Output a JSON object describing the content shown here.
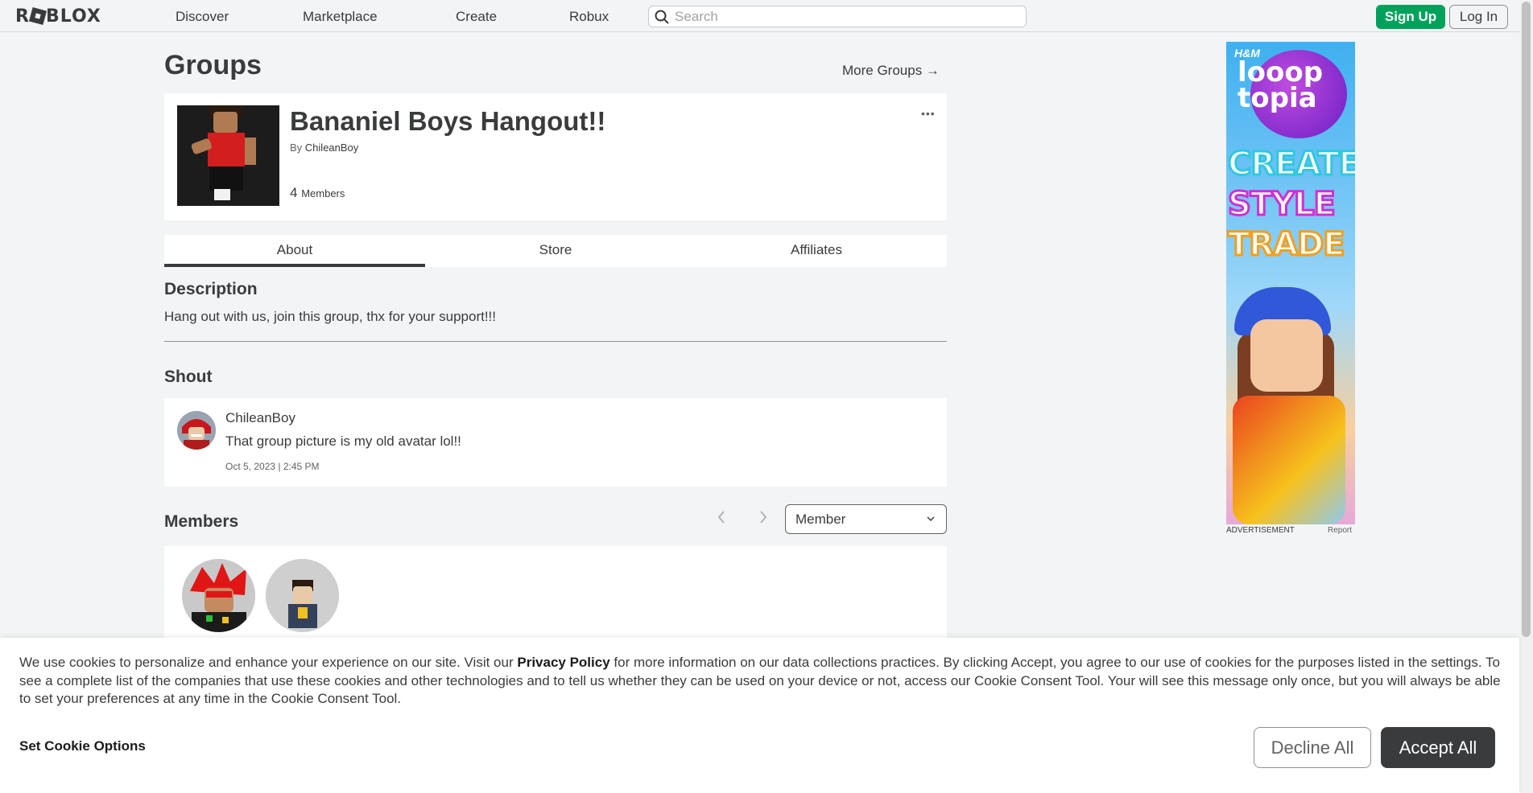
{
  "nav": {
    "logo": "ROBLOX",
    "links": [
      "Discover",
      "Marketplace",
      "Create",
      "Robux"
    ],
    "search_placeholder": "Search",
    "signup_label": "Sign Up",
    "login_label": "Log In"
  },
  "page": {
    "title": "Groups",
    "more_groups": "More Groups →"
  },
  "group": {
    "name": "Bananiel Boys Hangout!!",
    "by_prefix": "By",
    "owner": "ChileanBoy",
    "member_count": "4",
    "members_label": "Members",
    "menu_dots": "•••"
  },
  "tabs": [
    "About",
    "Store",
    "Affiliates"
  ],
  "about": {
    "description_heading": "Description",
    "description": "Hang out with us, join this group, thx for your support!!!",
    "shout_heading": "Shout",
    "shout": {
      "user": "ChileanBoy",
      "text": "That group picture is my old avatar lol!!",
      "time": "Oct 5, 2023 | 2:45 PM"
    },
    "members_heading": "Members",
    "role_select": "Member"
  },
  "ad": {
    "brand": "H&M",
    "headline": "looop topia",
    "words": [
      "CREATE",
      "STYLE",
      "TRADE"
    ],
    "caption": "ADVERTISEMENT",
    "report": "Report"
  },
  "cookie": {
    "text_before": "We use cookies to personalize and enhance your experience on our site. Visit our ",
    "privacy_link": "Privacy Policy",
    "text_after": " for more information on our data collections practices. By clicking Accept, you agree to our use of cookies for the purposes listed in the settings. To see a complete list of the companies that use these cookies and other technologies and to tell us whether they can be used on your device or not, access our Cookie Consent Tool. Your will see this message only once, but you will always be able to set your preferences at any time in the Cookie Consent Tool.",
    "options_label": "Set Cookie Options",
    "decline_label": "Decline All",
    "accept_label": "Accept All"
  },
  "colors": {
    "signup_green": "#00a25b",
    "accept_dark": "#393b3d",
    "page_bg": "#f2f4f5"
  }
}
